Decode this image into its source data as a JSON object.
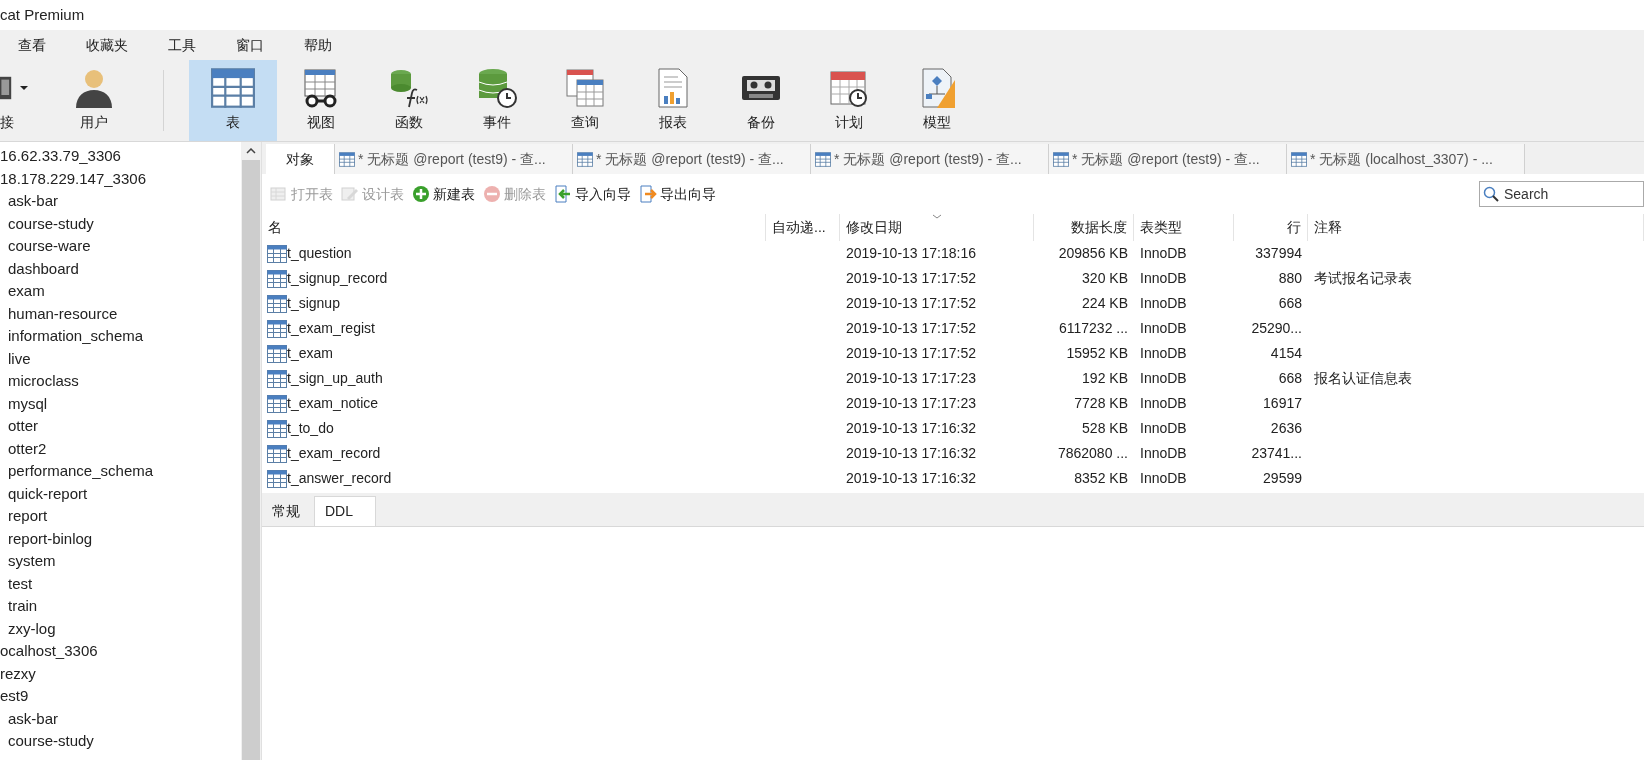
{
  "window": {
    "title": "cat Premium"
  },
  "menu": [
    "查看",
    "收藏夹",
    "工具",
    "窗口",
    "帮助"
  ],
  "toolbar": [
    {
      "label": "接",
      "selected": false,
      "dropdown": true
    },
    {
      "label": "用户",
      "selected": false,
      "dropdown": false
    },
    {
      "label": "表",
      "selected": true,
      "dropdown": false
    },
    {
      "label": "视图",
      "selected": false,
      "dropdown": false
    },
    {
      "label": "函数",
      "selected": false,
      "dropdown": false
    },
    {
      "label": "事件",
      "selected": false,
      "dropdown": false
    },
    {
      "label": "查询",
      "selected": false,
      "dropdown": false
    },
    {
      "label": "报表",
      "selected": false,
      "dropdown": false
    },
    {
      "label": "备份",
      "selected": false,
      "dropdown": false
    },
    {
      "label": "计划",
      "selected": false,
      "dropdown": false
    },
    {
      "label": "模型",
      "selected": false,
      "dropdown": false
    }
  ],
  "sidebar": {
    "items": [
      {
        "label": "16.62.33.79_3306"
      },
      {
        "label": "18.178.229.147_3306",
        "children": [
          {
            "label": "ask-bar"
          },
          {
            "label": "course-study"
          },
          {
            "label": "course-ware"
          },
          {
            "label": "dashboard"
          },
          {
            "label": "exam"
          },
          {
            "label": "human-resource"
          },
          {
            "label": "information_schema"
          },
          {
            "label": "live"
          },
          {
            "label": "microclass"
          },
          {
            "label": "mysql"
          },
          {
            "label": "otter"
          },
          {
            "label": "otter2"
          },
          {
            "label": "performance_schema"
          },
          {
            "label": "quick-report"
          },
          {
            "label": "report"
          },
          {
            "label": "report-binlog"
          },
          {
            "label": "system"
          },
          {
            "label": "test"
          },
          {
            "label": "train"
          },
          {
            "label": "zxy-log"
          }
        ]
      },
      {
        "label": "ocalhost_3306"
      },
      {
        "label": "rezxy"
      },
      {
        "label": "est9",
        "children": [
          {
            "label": "ask-bar"
          },
          {
            "label": "course-study"
          }
        ]
      }
    ]
  },
  "tabs": [
    {
      "label": "对象",
      "selected": true,
      "kind": "objects"
    },
    {
      "label": "* 无标题 @report (test9) - 查...",
      "selected": false,
      "kind": "query"
    },
    {
      "label": "* 无标题 @report (test9) - 查...",
      "selected": false,
      "kind": "query"
    },
    {
      "label": "* 无标题 @report (test9) - 查...",
      "selected": false,
      "kind": "query"
    },
    {
      "label": "* 无标题 @report (test9) - 查...",
      "selected": false,
      "kind": "query"
    },
    {
      "label": "* 无标题 (localhost_3307) - ...",
      "selected": false,
      "kind": "query"
    }
  ],
  "actions": [
    {
      "label": "打开表",
      "disabled": true
    },
    {
      "label": "设计表",
      "disabled": true
    },
    {
      "label": "新建表",
      "disabled": false
    },
    {
      "label": "删除表",
      "disabled": true
    },
    {
      "label": "导入向导",
      "disabled": false
    },
    {
      "label": "导出向导",
      "disabled": false
    }
  ],
  "search": {
    "placeholder": "Search"
  },
  "table": {
    "columns": [
      {
        "label": "名",
        "sorted": false
      },
      {
        "label": "自动递...",
        "sorted": false
      },
      {
        "label": "修改日期",
        "sorted": true
      },
      {
        "label": "数据长度",
        "sorted": false
      },
      {
        "label": "表类型",
        "sorted": false
      },
      {
        "label": "行",
        "sorted": false
      },
      {
        "label": "注释",
        "sorted": false
      }
    ],
    "rows": [
      [
        "t_question",
        "",
        "2019-10-13 17:18:16",
        "209856 KB",
        "InnoDB",
        "337994",
        ""
      ],
      [
        "t_signup_record",
        "",
        "2019-10-13 17:17:52",
        "320 KB",
        "InnoDB",
        "880",
        "考试报名记录表"
      ],
      [
        "t_signup",
        "",
        "2019-10-13 17:17:52",
        "224 KB",
        "InnoDB",
        "668",
        ""
      ],
      [
        "t_exam_regist",
        "",
        "2019-10-13 17:17:52",
        "6117232 ...",
        "InnoDB",
        "25290...",
        ""
      ],
      [
        "t_exam",
        "",
        "2019-10-13 17:17:52",
        "15952 KB",
        "InnoDB",
        "4154",
        ""
      ],
      [
        "t_sign_up_auth",
        "",
        "2019-10-13 17:17:23",
        "192 KB",
        "InnoDB",
        "668",
        "报名认证信息表"
      ],
      [
        "t_exam_notice",
        "",
        "2019-10-13 17:17:23",
        "7728 KB",
        "InnoDB",
        "16917",
        ""
      ],
      [
        "t_to_do",
        "",
        "2019-10-13 17:16:32",
        "528 KB",
        "InnoDB",
        "2636",
        ""
      ],
      [
        "t_exam_record",
        "",
        "2019-10-13 17:16:32",
        "7862080 ...",
        "InnoDB",
        "23741...",
        ""
      ],
      [
        "t_answer_record",
        "",
        "2019-10-13 17:16:32",
        "8352 KB",
        "InnoDB",
        "29599",
        ""
      ]
    ]
  },
  "bottom_tabs": [
    {
      "label": "常规",
      "selected": false
    },
    {
      "label": "DDL",
      "selected": true
    }
  ]
}
